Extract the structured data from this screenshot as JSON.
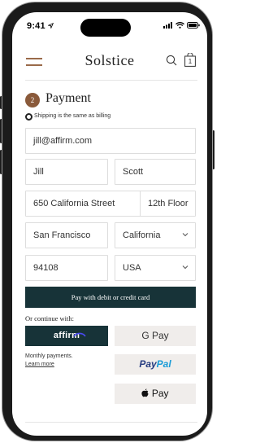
{
  "status_bar": {
    "time": "9:41"
  },
  "header": {
    "brand": "Solstice",
    "cart_count": "1"
  },
  "payment": {
    "step_number": "2",
    "title": "Payment",
    "shipping_same_label": "Shipping is the same as billing",
    "email": "jill@affirm.com",
    "first_name": "Jill",
    "last_name": "Scott",
    "address_line1": "650 California Street",
    "address_line2": "12th Floor",
    "city": "San Francisco",
    "state": "California",
    "zip": "94108",
    "country": "USA",
    "pay_card_label": "Pay with debit or credit card",
    "continue_label": "Or continue with:",
    "affirm_label": "affirm",
    "monthly_label": "Monthly payments.",
    "learn_more_label": "Learn more",
    "gpay_label": "G Pay",
    "paypal_part1": "Pay",
    "paypal_part2": "Pal",
    "applepay_label": "Pay"
  },
  "colors": {
    "accent_brown": "#8a5a3b",
    "primary_button": "#173338",
    "secondary_button": "#f0edeb",
    "paypal_dark": "#253b80",
    "paypal_light": "#179bd7"
  }
}
